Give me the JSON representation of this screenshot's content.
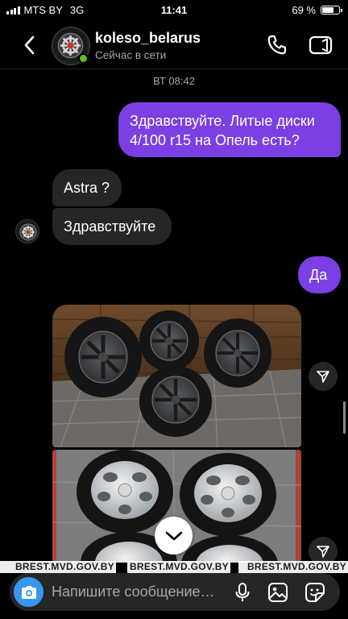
{
  "status_bar": {
    "carrier": "MTS BY",
    "network": "3G",
    "time": "11:41",
    "battery": "69 %",
    "battery_level": 0.69
  },
  "header": {
    "username": "koleso_belarus",
    "presence": "Сейчас в сети",
    "online_color": "#58c322",
    "icons": [
      "back-chevron-icon",
      "phone-icon",
      "video-camera-icon"
    ]
  },
  "timestamp": "ВТ 08:42",
  "messages": [
    {
      "from": "me",
      "text": "Здравствуйте. Литые диски 4/100 r15 на Опель есть?"
    },
    {
      "from": "them",
      "text": "Astra ?"
    },
    {
      "from": "them",
      "text": "Здравствуйте"
    },
    {
      "from": "me",
      "text": "Да"
    },
    {
      "from": "them",
      "type": "photo",
      "description": "dark-alloy-wheels"
    },
    {
      "from": "them",
      "type": "photo",
      "description": "silver-alloy-wheels"
    }
  ],
  "colors": {
    "sent_bubble": "#7b3fe4",
    "received_bubble": "#262626",
    "accent": "#3797f0",
    "background": "#000000"
  },
  "watermark": [
    "BREST.MVD.GOV.BY",
    "BREST.MVD.GOV.BY",
    "BREST.MVD.GOV.BY"
  ],
  "composer": {
    "placeholder": "Напишите сообщение…",
    "icons": [
      "camera-icon",
      "microphone-icon",
      "gallery-icon",
      "sticker-icon"
    ]
  }
}
